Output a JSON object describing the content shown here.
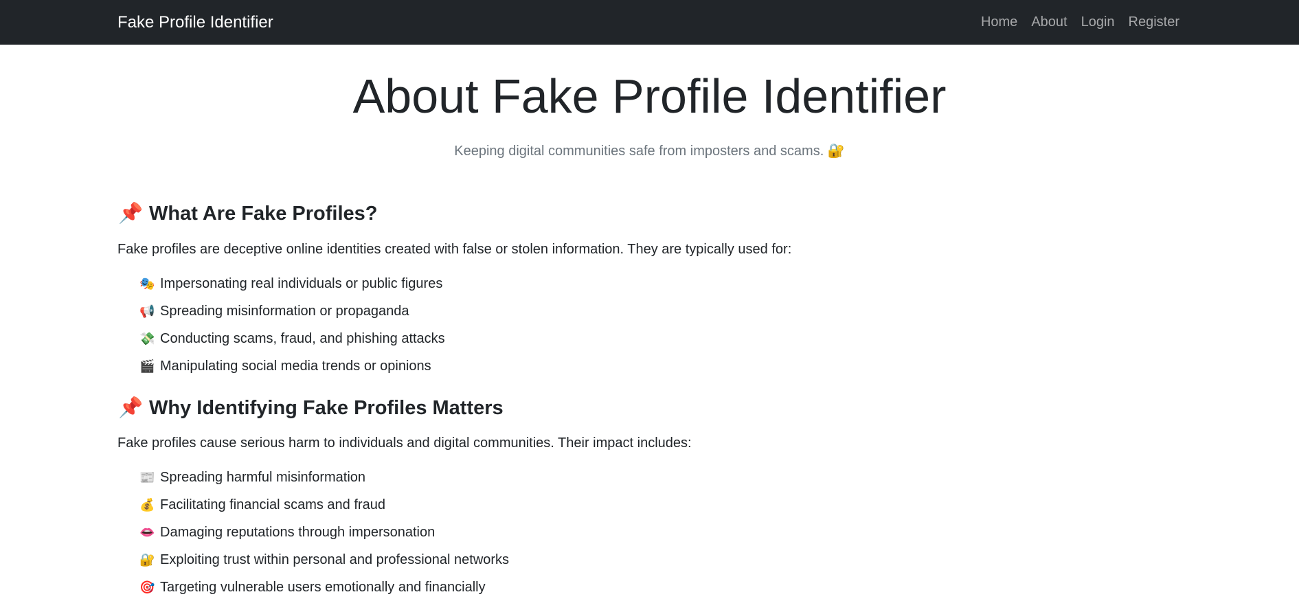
{
  "navbar": {
    "brand": "Fake Profile Identifier",
    "links": [
      "Home",
      "About",
      "Login",
      "Register"
    ]
  },
  "hero": {
    "title": "About Fake Profile Identifier",
    "lead": "Keeping digital communities safe from imposters and scams.",
    "lead_icon": "🔐"
  },
  "sections": [
    {
      "icon": "📌",
      "icon_name": "pushpin-icon",
      "title": "What Are Fake Profiles?",
      "intro": "Fake profiles are deceptive online identities created with false or stolen information. They are typically used for:",
      "items": [
        {
          "icon": "🎭",
          "icon_name": "theater-masks-icon",
          "text": "Impersonating real individuals or public figures"
        },
        {
          "icon": "📢",
          "icon_name": "megaphone-icon",
          "text": "Spreading misinformation or propaganda"
        },
        {
          "icon": "💸",
          "icon_name": "money-with-wings-icon",
          "text": "Conducting scams, fraud, and phishing attacks"
        },
        {
          "icon": "🎬",
          "icon_name": "clapper-board-icon",
          "text": "Manipulating social media trends or opinions"
        }
      ]
    },
    {
      "icon": "📌",
      "icon_name": "pushpin-icon",
      "title": "Why Identifying Fake Profiles Matters",
      "intro": "Fake profiles cause serious harm to individuals and digital communities. Their impact includes:",
      "items": [
        {
          "icon": "📰",
          "icon_name": "newspaper-icon",
          "text": "Spreading harmful misinformation"
        },
        {
          "icon": "💰",
          "icon_name": "money-bag-icon",
          "text": "Facilitating financial scams and fraud"
        },
        {
          "icon": "👄",
          "icon_name": "mouth-icon",
          "text": "Damaging reputations through impersonation"
        },
        {
          "icon": "🔐",
          "icon_name": "lock-with-key-icon",
          "text": "Exploiting trust within personal and professional networks"
        },
        {
          "icon": "🎯",
          "icon_name": "target-icon",
          "text": "Targeting vulnerable users emotionally and financially"
        }
      ]
    }
  ]
}
